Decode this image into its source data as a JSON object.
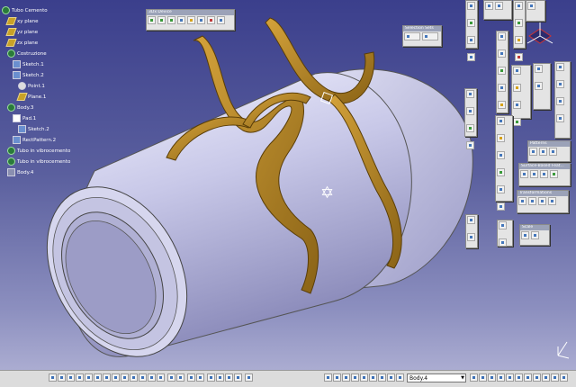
{
  "tree": {
    "items": [
      {
        "label": "Tubo Cemento",
        "icon": "product-icon"
      },
      {
        "label": "xy plane",
        "icon": "plane-icon"
      },
      {
        "label": "yz plane",
        "icon": "plane-icon"
      },
      {
        "label": "zx plane",
        "icon": "plane-icon"
      },
      {
        "label": "Costruzione",
        "icon": "gear-icon"
      },
      {
        "label": "Sketch.1",
        "icon": "sketch-icon"
      },
      {
        "label": "Sketch.2",
        "icon": "sketch-icon"
      },
      {
        "label": "Point.1",
        "icon": "point-icon"
      },
      {
        "label": "Plane.1",
        "icon": "plane-icon"
      },
      {
        "label": "Body.3",
        "icon": "gear-icon"
      },
      {
        "label": "Pad.1",
        "icon": "pad-icon"
      },
      {
        "label": "Sketch.2",
        "icon": "sketch-icon"
      },
      {
        "label": "RectPattern.2",
        "icon": "pattern-icon"
      },
      {
        "label": "Tubo in vibrocemento",
        "icon": "gear-icon"
      },
      {
        "label": "Tubo in vibrocemento",
        "icon": "gear-icon"
      },
      {
        "label": "Body.4",
        "icon": "body-icon"
      }
    ]
  },
  "toolbars": {
    "device": "3Dx Device",
    "selection": "Selection Sets",
    "patterns": "Patterns",
    "surface": "Surface-Based Feat...",
    "transformations": "Transformations",
    "scale": "Scale"
  },
  "statusbar": {
    "body_select": "Body.4"
  },
  "colors": {
    "background_top": "#3b3f8c",
    "background_bottom": "#b3b4d6",
    "pipe": "#c9c9e6",
    "clamp": "#b8862a"
  }
}
